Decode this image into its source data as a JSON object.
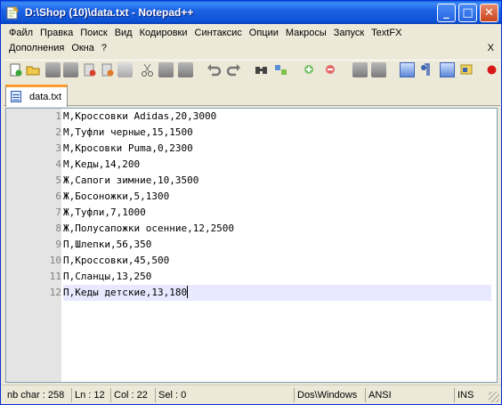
{
  "window": {
    "title": "D:\\Shop (10)\\data.txt - Notepad++",
    "minimize_glyph": "_",
    "maximize_glyph": "□",
    "close_glyph": "✕"
  },
  "menu": {
    "row1": [
      "Файл",
      "Правка",
      "Поиск",
      "Вид",
      "Кодировки",
      "Синтаксис",
      "Опции",
      "Макросы",
      "Запуск",
      "TextFX"
    ],
    "row2": [
      "Дополнения",
      "Окна",
      "?"
    ],
    "close_doc": "X"
  },
  "toolbar": {
    "icons": [
      "new-file-icon",
      "open-file-icon",
      "save-icon",
      "save-all-icon",
      "close-icon",
      "close-all-icon",
      "print-icon",
      "cut-icon",
      "copy-icon",
      "paste-icon",
      "undo-icon",
      "redo-icon",
      "find-icon",
      "replace-icon",
      "zoom-in-icon",
      "zoom-out-icon",
      "sync-v-icon",
      "sync-h-icon",
      "word-wrap-icon",
      "all-chars-icon",
      "indent-guide-icon",
      "udl-icon",
      "record-macro-icon"
    ]
  },
  "tabs": [
    {
      "label": "data.txt"
    }
  ],
  "editor": {
    "lines": [
      "М,Кроссовки Adidas,20,3000",
      "М,Туфли черные,15,1500",
      "М,Кросовки Puma,0,2300",
      "М,Кеды,14,200",
      "Ж,Сапоги зимние,10,3500",
      "Ж,Босоножки,5,1300",
      "Ж,Туфли,7,1000",
      "Ж,Полусапожки осенние,12,2500",
      "П,Шлепки,56,350",
      "П,Кроссовки,45,500",
      "П,Сланцы,13,250",
      "П,Кеды детские,13,180"
    ],
    "line_numbers": [
      "1",
      "2",
      "3",
      "4",
      "5",
      "6",
      "7",
      "8",
      "9",
      "10",
      "11",
      "12"
    ],
    "current_line": 12
  },
  "status": {
    "chars": "nb char : 258",
    "line": "Ln : 12",
    "col": "Col : 22",
    "sel": "Sel : 0",
    "eol": "Dos\\Windows",
    "encoding": "ANSI",
    "mode": "INS"
  },
  "colors": {
    "title_bar": "#0c52d4",
    "current_line_bg": "#e8e8ff",
    "tab_accent": "#fa9a2b",
    "gutter_bg": "#e4e4e4"
  }
}
